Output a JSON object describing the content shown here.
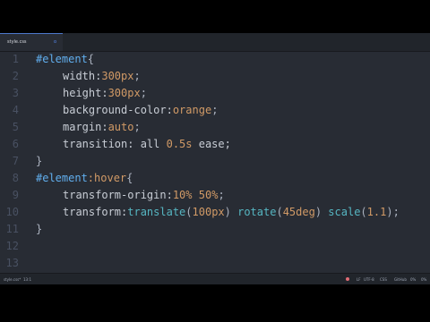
{
  "tab": {
    "title": "style.css",
    "close_glyph": "o"
  },
  "line_numbers": [
    "1",
    "2",
    "3",
    "4",
    "5",
    "6",
    "7",
    "8",
    "9",
    "10",
    "11",
    "12",
    "13"
  ],
  "code": {
    "l1": {
      "selector": "#element",
      "brace": "{"
    },
    "l2": {
      "prop": "width:",
      "num": "300px",
      "end": ";"
    },
    "l3": {
      "prop": "height:",
      "num": "300px",
      "end": ";"
    },
    "l4": {
      "prop": "background-color:",
      "val": "orange",
      "end": ";"
    },
    "l5": {
      "prop": "margin:",
      "val": "auto",
      "end": ";"
    },
    "l6": {
      "prop": "transition: all ",
      "num": "0.5s",
      "rest": " ease;"
    },
    "l7": {
      "brace": "}"
    },
    "l8": {
      "selector": "#element",
      "pseudo": ":hover",
      "brace": "{"
    },
    "l9": {
      "prop": "transform-origin:",
      "num1": "10%",
      "sp": " ",
      "num2": "50%",
      "end": ";"
    },
    "l10": {
      "prop": "transform:",
      "fn1": "translate",
      "p1o": "(",
      "a1": "100px",
      "p1c": ")",
      "s1": " ",
      "fn2": "rotate",
      "p2o": "(",
      "a2": "45deg",
      "p2c": ")",
      "s2": " ",
      "fn3": "scale",
      "p3o": "(",
      "a3": "1.1",
      "p3c": ");"
    },
    "l11": {
      "brace": "}"
    }
  },
  "status_bar": {
    "file": "style.css*",
    "cursor": "13:1",
    "line_ending": "LF",
    "encoding": "UTF-8",
    "grammar": "CSS",
    "git": "GitHub",
    "diff": "0%",
    "extra": "0%"
  },
  "colors": {
    "editor_bg": "#282c34",
    "selector": "#61afef",
    "number": "#d19a66",
    "function": "#56b6c2",
    "text": "#abb2bf"
  }
}
